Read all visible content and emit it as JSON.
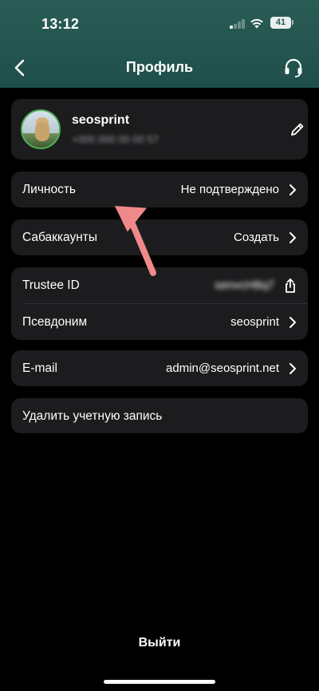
{
  "status_bar": {
    "time": "13:12",
    "battery": "41"
  },
  "nav": {
    "title": "Профиль",
    "back_icon": "chevron-left-icon",
    "support_icon": "headset-icon"
  },
  "profile": {
    "name": "seosprint",
    "phone": "+000 000 00 00 57",
    "edit_icon": "pencil-icon"
  },
  "rows": {
    "identity": {
      "label": "Личность",
      "value": "Не подтверждено"
    },
    "subaccounts": {
      "label": "Сабаккаунты",
      "value": "Создать"
    },
    "trustee": {
      "label": "Trustee ID",
      "value": "senvcH8q7"
    },
    "alias": {
      "label": "Псевдоним",
      "value": "seosprint"
    },
    "email": {
      "label": "E-mail",
      "value": "admin@seosprint.net"
    },
    "delete": {
      "label": "Удалить учетную запись"
    }
  },
  "logout": "Выйти",
  "colors": {
    "header": "#2a5c56",
    "card": "#1c1c1e",
    "annotation_arrow": "#f08a8a"
  }
}
